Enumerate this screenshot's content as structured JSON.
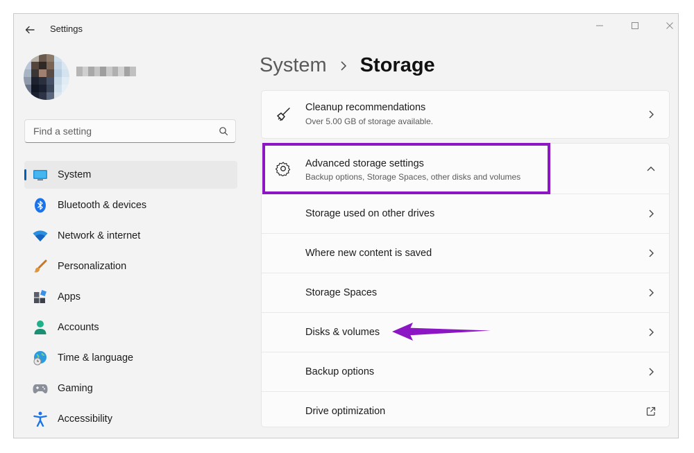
{
  "window": {
    "title": "Settings",
    "controls": [
      "minimize",
      "maximize",
      "close"
    ]
  },
  "search": {
    "placeholder": "Find a setting",
    "value": ""
  },
  "nav": {
    "items": [
      {
        "label": "System",
        "icon": "system-icon",
        "active": true
      },
      {
        "label": "Bluetooth & devices",
        "icon": "bluetooth-icon"
      },
      {
        "label": "Network & internet",
        "icon": "wifi-icon"
      },
      {
        "label": "Personalization",
        "icon": "paintbrush-icon"
      },
      {
        "label": "Apps",
        "icon": "apps-icon"
      },
      {
        "label": "Accounts",
        "icon": "person-icon"
      },
      {
        "label": "Time & language",
        "icon": "globe-clock-icon"
      },
      {
        "label": "Gaming",
        "icon": "gamepad-icon"
      },
      {
        "label": "Accessibility",
        "icon": "accessibility-icon"
      }
    ]
  },
  "breadcrumb": {
    "parent": "System",
    "current": "Storage"
  },
  "cleanup": {
    "title": "Cleanup recommendations",
    "description": "Over 5.00 GB of storage available.",
    "icon": "broom-icon"
  },
  "advanced": {
    "title": "Advanced storage settings",
    "description": "Backup options, Storage Spaces, other disks and volumes",
    "icon": "gear-icon",
    "expanded": true,
    "items": [
      {
        "label": "Storage used on other drives",
        "icon": "chevron-right-icon"
      },
      {
        "label": "Where new content is saved",
        "icon": "chevron-right-icon"
      },
      {
        "label": "Storage Spaces",
        "icon": "chevron-right-icon"
      },
      {
        "label": "Disks & volumes",
        "icon": "chevron-right-icon"
      },
      {
        "label": "Backup options",
        "icon": "chevron-right-icon"
      },
      {
        "label": "Drive optimization",
        "icon": "external-link-icon"
      }
    ]
  },
  "annotation": {
    "highlight_color": "#8c16c4",
    "arrow_color": "#8c16c4"
  },
  "colors": {
    "accent": "#005fb8",
    "window_bg": "#f3f3f3",
    "card_bg": "#fbfbfb"
  }
}
